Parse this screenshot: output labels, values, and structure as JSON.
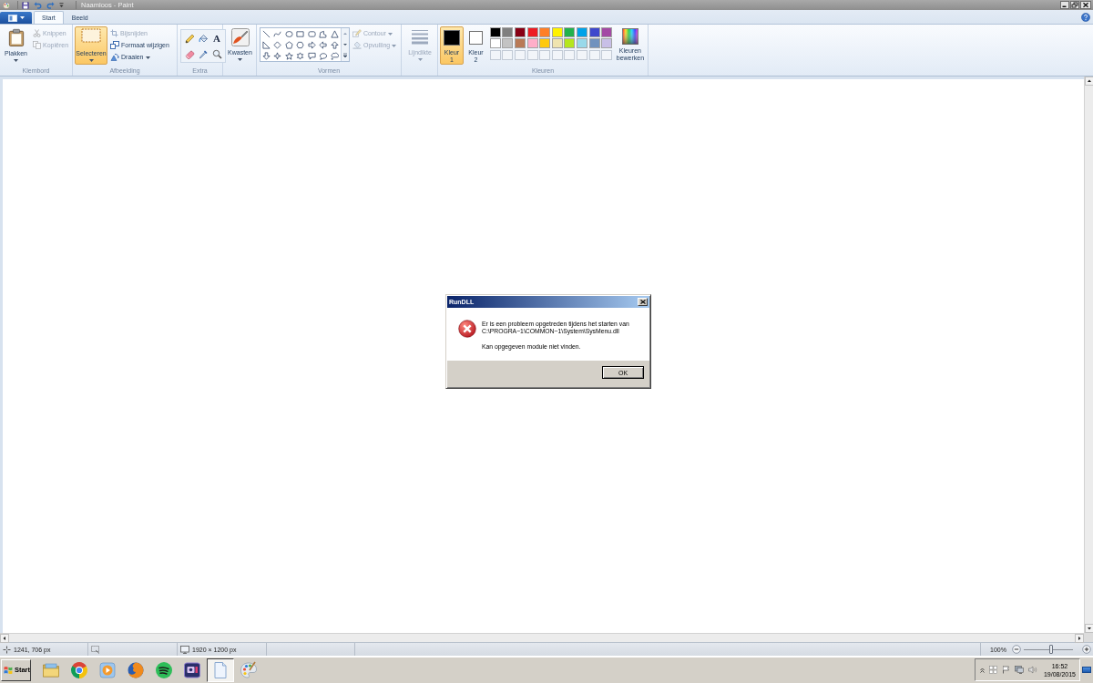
{
  "title_bar": {
    "title": "Naamloos - Paint"
  },
  "tabs": [
    {
      "label": "Start",
      "selected": true
    },
    {
      "label": "Beeld",
      "selected": false
    }
  ],
  "ribbon": {
    "clipboard": {
      "label": "Klembord",
      "paste": {
        "label": "Plakken",
        "disabled": false
      },
      "cut": {
        "label": "Knippen",
        "disabled": true
      },
      "copy": {
        "label": "Kopiëren",
        "disabled": true
      }
    },
    "image": {
      "label": "Afbeelding",
      "select": {
        "label": "Selecteren",
        "selected": true
      },
      "crop": {
        "label": "Bijsnijden",
        "disabled": true
      },
      "resize": {
        "label": "Formaat wijzigen",
        "disabled": false
      },
      "rotate": {
        "label": "Draaien",
        "disabled": false
      }
    },
    "tools": {
      "label": "Extra",
      "text_tool": "A"
    },
    "brushes": {
      "label": "Kwasten",
      "disabled": false
    },
    "shapes": {
      "label": "Vormen",
      "outline": {
        "label": "Contour",
        "disabled": true
      },
      "fill": {
        "label": "Opvulling",
        "disabled": true
      }
    },
    "size": {
      "label": "Lijndikte",
      "disabled": true
    },
    "colors": {
      "label": "Kleuren",
      "color_1": {
        "label": "Kleur 1",
        "selected": true,
        "color": "#000000"
      },
      "color_2": {
        "label": "Kleur 2",
        "selected": false,
        "color": "#ffffff"
      },
      "palette": [
        {
          "kind": "swatch",
          "color": "#000000"
        },
        {
          "kind": "swatch",
          "color": "#7f7f7f"
        },
        {
          "kind": "swatch",
          "color": "#880015"
        },
        {
          "kind": "swatch",
          "color": "#ed1c24"
        },
        {
          "kind": "swatch",
          "color": "#ff7f27"
        },
        {
          "kind": "swatch",
          "color": "#fff200"
        },
        {
          "kind": "swatch",
          "color": "#22b14c"
        },
        {
          "kind": "swatch",
          "color": "#00a2e8"
        },
        {
          "kind": "swatch",
          "color": "#3f48cc"
        },
        {
          "kind": "swatch",
          "color": "#a349a4"
        },
        {
          "kind": "swatch",
          "color": "#ffffff"
        },
        {
          "kind": "swatch",
          "color": "#c3c3c3"
        },
        {
          "kind": "swatch",
          "color": "#b97a57"
        },
        {
          "kind": "swatch",
          "color": "#ffaec9"
        },
        {
          "kind": "swatch",
          "color": "#ffc90e"
        },
        {
          "kind": "swatch",
          "color": "#efe4b0"
        },
        {
          "kind": "swatch",
          "color": "#b5e61d"
        },
        {
          "kind": "swatch",
          "color": "#99d9ea"
        },
        {
          "kind": "swatch",
          "color": "#7092be"
        },
        {
          "kind": "swatch",
          "color": "#c8bfe7"
        },
        {
          "kind": "empty"
        },
        {
          "kind": "empty"
        },
        {
          "kind": "empty"
        },
        {
          "kind": "empty"
        },
        {
          "kind": "empty"
        },
        {
          "kind": "empty"
        },
        {
          "kind": "empty"
        },
        {
          "kind": "empty"
        },
        {
          "kind": "empty"
        },
        {
          "kind": "empty"
        }
      ],
      "edit": {
        "label": "Kleuren bewerken"
      }
    }
  },
  "dialog": {
    "title": "RunDLL",
    "message": "Er is een probleem opgetreden tijdens het starten van C:\\PROGRA~1\\COMMON~1\\System\\SysMenu.dll",
    "detail": "Kan opgegeven module niet vinden.",
    "button": "OK"
  },
  "status_bar": {
    "cursor_position": "1241, 706 px",
    "image_size": "1920 × 1200 px",
    "zoom": "100%",
    "zoom_slider": {
      "level": 0.55
    }
  },
  "taskbar": {
    "start": "Start",
    "apps": [
      {
        "kind": "folder",
        "selected": false
      },
      {
        "kind": "ring",
        "selected": false
      },
      {
        "kind": "play",
        "selected": false
      },
      {
        "kind": "globe",
        "selected": false
      },
      {
        "kind": "waves",
        "selected": false
      },
      {
        "kind": "screen",
        "selected": false
      },
      {
        "kind": "page",
        "selected": true
      },
      {
        "kind": "palette",
        "selected": false
      }
    ],
    "clock_time": "16:52",
    "clock_date": "19/08/2015"
  }
}
